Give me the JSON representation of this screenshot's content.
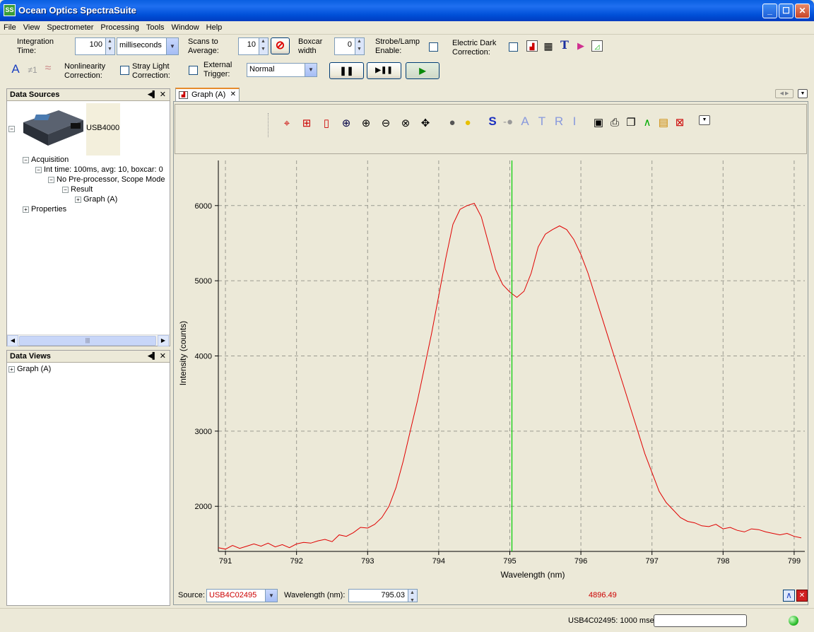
{
  "window": {
    "title": "Ocean Optics SpectraSuite",
    "icon": "SS"
  },
  "menu": [
    "File",
    "View",
    "Spectrometer",
    "Processing",
    "Tools",
    "Window",
    "Help"
  ],
  "toolbar": {
    "integration_label_1": "Integration",
    "integration_label_2": "Time:",
    "integration_value": "100",
    "integration_unit": "milliseconds",
    "scans_label_1": "Scans to",
    "scans_label_2": "Average:",
    "scans_value": "10",
    "boxcar_label_1": "Boxcar",
    "boxcar_label_2": "width",
    "boxcar_value": "0",
    "strobe_label_1": "Strobe/Lamp",
    "strobe_label_2": "Enable:",
    "dark_label_1": "Electric Dark",
    "dark_label_2": "Correction:",
    "nonlin_label_1": "Nonlinearity",
    "nonlin_label_2": "Correction:",
    "stray_label_1": "Stray Light",
    "stray_label_2": "Correction:",
    "trigger_label_1": "External",
    "trigger_label_2": "Trigger:",
    "trigger_value": "Normal",
    "icon_a": "A",
    "icon_neq1": "≠1"
  },
  "data_sources": {
    "title": "Data Sources",
    "device": "USB4000",
    "acquisition": "Acquisition",
    "int_time": "Int time: 100ms, avg: 10, boxcar: 0",
    "preprocessor": "No Pre-processor, Scope Mode",
    "result": "Result",
    "graph": "Graph (A)",
    "properties": "Properties"
  },
  "data_views": {
    "title": "Data Views",
    "graph": "Graph (A)"
  },
  "graph_tab": {
    "label": "Graph (A)"
  },
  "graph_toolbar": {
    "letters": [
      "S",
      "A",
      "T",
      "R",
      "I"
    ]
  },
  "chart_data": {
    "type": "line",
    "xlabel": "Wavelength (nm)",
    "ylabel": "Intensity (counts)",
    "xlim": [
      790.9,
      799.15
    ],
    "ylim": [
      1400,
      6600
    ],
    "xticks": [
      791,
      792,
      793,
      794,
      795,
      796,
      797,
      798,
      799
    ],
    "yticks": [
      2000,
      3000,
      4000,
      5000,
      6000
    ],
    "grid": true,
    "cursor_x": 795.03,
    "line_color": "#e00000",
    "cursor_color": "#00cc00",
    "series": [
      {
        "x": [
          790.9,
          791.0,
          791.1,
          791.2,
          791.3,
          791.4,
          791.5,
          791.6,
          791.7,
          791.8,
          791.9,
          792.0,
          792.1,
          792.2,
          792.3,
          792.4,
          792.5,
          792.6,
          792.7,
          792.8,
          792.9,
          793.0,
          793.1,
          793.2,
          793.3,
          793.4,
          793.5,
          793.6,
          793.7,
          793.8,
          793.9,
          794.0,
          794.1,
          794.2,
          794.3,
          794.4,
          794.5,
          794.6,
          794.7,
          794.8,
          794.9,
          795.0,
          795.1,
          795.2,
          795.3,
          795.4,
          795.5,
          795.6,
          795.7,
          795.8,
          795.9,
          796.0,
          796.1,
          796.2,
          796.3,
          796.4,
          796.5,
          796.6,
          796.7,
          796.8,
          796.9,
          797.0,
          797.1,
          797.2,
          797.3,
          797.4,
          797.5,
          797.6,
          797.7,
          797.8,
          797.9,
          798.0,
          798.1,
          798.2,
          798.3,
          798.4,
          798.5,
          798.6,
          798.7,
          798.8,
          798.9,
          799.0,
          799.1
        ],
        "y": [
          1450,
          1430,
          1480,
          1440,
          1470,
          1500,
          1470,
          1510,
          1460,
          1490,
          1450,
          1500,
          1520,
          1510,
          1540,
          1560,
          1530,
          1620,
          1600,
          1650,
          1720,
          1710,
          1760,
          1850,
          2000,
          2250,
          2600,
          3000,
          3400,
          3850,
          4300,
          4800,
          5300,
          5750,
          5950,
          6000,
          6030,
          5850,
          5500,
          5150,
          4950,
          4850,
          4780,
          4860,
          5100,
          5450,
          5620,
          5680,
          5730,
          5680,
          5550,
          5350,
          5100,
          4800,
          4500,
          4200,
          3900,
          3600,
          3300,
          3000,
          2700,
          2450,
          2200,
          2050,
          1950,
          1850,
          1800,
          1780,
          1740,
          1730,
          1760,
          1700,
          1720,
          1680,
          1660,
          1700,
          1690,
          1660,
          1640,
          1620,
          1640,
          1600,
          1580
        ]
      }
    ]
  },
  "graph_footer": {
    "source_label": "Source:",
    "source_value": "USB4C02495",
    "wavelength_label": "Wavelength (nm):",
    "wavelength_value": "795.03",
    "intensity_value": "4896.49"
  },
  "status": {
    "text": "USB4C02495: 1000 msec"
  }
}
